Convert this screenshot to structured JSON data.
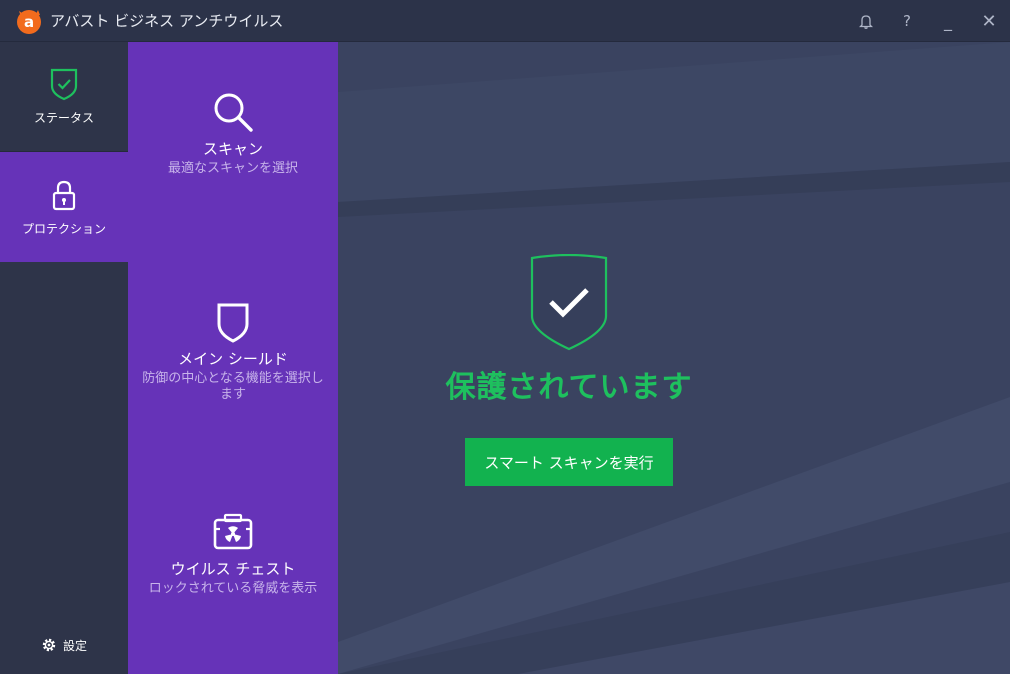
{
  "window": {
    "title": "アバスト ビジネス アンチウイルス"
  },
  "titlebar": {
    "notifications_icon": "bell-icon",
    "help_label": "?",
    "minimize_label": "_",
    "close_label": "✕"
  },
  "nav": {
    "status": {
      "label": "ステータス",
      "icon": "shield-check-icon"
    },
    "protection": {
      "label": "プロテクション",
      "icon": "lock-icon"
    },
    "settings": {
      "label": "設定",
      "icon": "gear-icon"
    }
  },
  "submenu": {
    "items": [
      {
        "title": "スキャン",
        "desc": "最適なスキャンを選択",
        "icon": "magnifier-icon"
      },
      {
        "title": "メイン シールド",
        "desc": "防御の中心となる機能を選択します",
        "icon": "shield-icon"
      },
      {
        "title": "ウイルス チェスト",
        "desc": "ロックされている脅威を表示",
        "icon": "virus-chest-icon"
      }
    ]
  },
  "main": {
    "status_text": "保護されています",
    "scan_button": "スマート スキャンを実行"
  },
  "colors": {
    "accent_purple": "#6633b8",
    "success_green": "#1ec05e",
    "button_green": "#12b24f",
    "sidebar": "#2e3449",
    "main_bg": "#3a4360",
    "logo_orange": "#f26b1d"
  }
}
